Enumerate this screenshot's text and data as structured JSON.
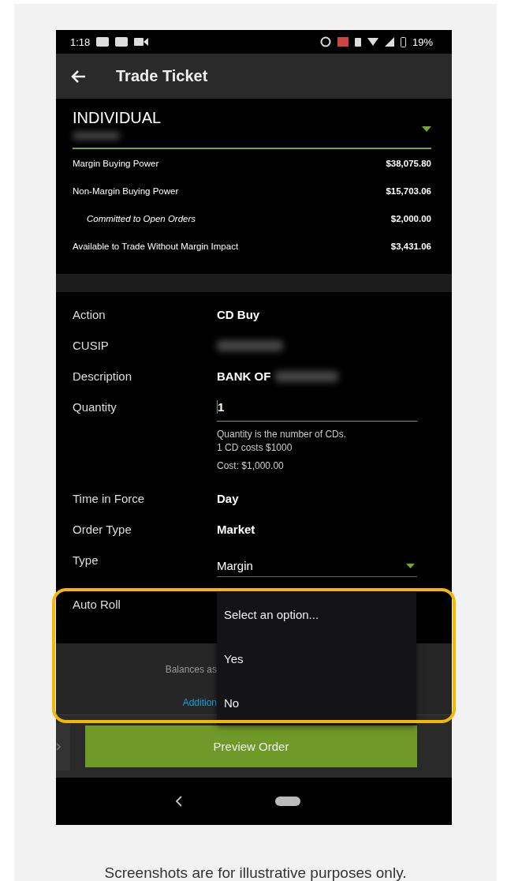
{
  "status_bar": {
    "time": "1:18",
    "battery": "19%"
  },
  "app_bar": {
    "title": "Trade Ticket"
  },
  "account": {
    "name": "INDIVIDUAL",
    "balances": [
      {
        "label": "Margin Buying Power",
        "value": "$38,075.80",
        "kind": "main"
      },
      {
        "label": "Non-Margin Buying Power",
        "value": "$15,703.06",
        "kind": "main"
      },
      {
        "label": "Committed to Open Orders",
        "value": "$2,000.00",
        "kind": "sub"
      },
      {
        "label": "Available to Trade Without Margin Impact",
        "value": "$3,431.06",
        "kind": "main"
      }
    ]
  },
  "form": [
    {
      "label": "Action",
      "value": "CD Buy",
      "kind": "text"
    },
    {
      "label": "CUSIP",
      "kind": "redacted"
    },
    {
      "label": "Description",
      "value": "BANK OF",
      "kind": "partly-redacted"
    },
    {
      "label": "Quantity",
      "value": "1",
      "kind": "input",
      "hints": [
        "Quantity is the number of CDs.",
        "1 CD costs $1000"
      ],
      "cost": "Cost: $1,000.00"
    },
    {
      "label": "Time in Force",
      "value": "Day",
      "kind": "text"
    },
    {
      "label": "Order Type",
      "value": "Market",
      "kind": "text"
    },
    {
      "label": "Type",
      "value": "Margin",
      "kind": "select"
    },
    {
      "label": "Auto Roll",
      "kind": "open-select"
    }
  ],
  "dropdown": {
    "options": [
      {
        "label": "Select an option...",
        "selected": false
      },
      {
        "label": "Yes",
        "selected": false
      },
      {
        "label": "No",
        "selected": false
      }
    ]
  },
  "footer": {
    "balances_note": "Balances as",
    "link": "Addition"
  },
  "preview_button": "Preview Order",
  "caption": "Screenshots are for illustrative purposes only."
}
